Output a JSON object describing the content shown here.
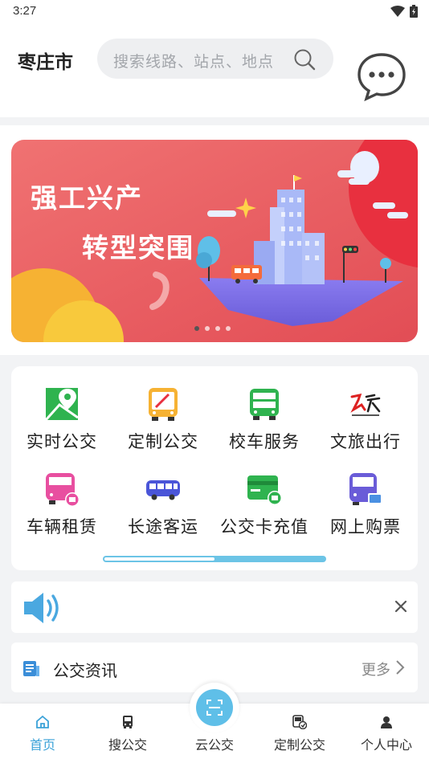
{
  "status_bar": {
    "time": "3:27"
  },
  "header": {
    "city": "枣庄市",
    "search_placeholder": "搜索线路、站点、地点"
  },
  "banner": {
    "line1": "强工兴产",
    "line2": "转型突围",
    "page_count": 4,
    "active_page": 1
  },
  "services": [
    {
      "label": "实时公交",
      "icon": "map-pin-icon"
    },
    {
      "label": "定制公交",
      "icon": "custom-bus-icon"
    },
    {
      "label": "校车服务",
      "icon": "school-bus-icon"
    },
    {
      "label": "文旅出行",
      "icon": "culture-travel-logo-icon"
    },
    {
      "label": "车辆租赁",
      "icon": "rental-bus-icon"
    },
    {
      "label": "长途客运",
      "icon": "coach-bus-icon"
    },
    {
      "label": "公交卡充值",
      "icon": "card-recharge-icon"
    },
    {
      "label": "网上购票",
      "icon": "ticket-bus-icon"
    }
  ],
  "services_scroll_fraction": 0.5,
  "news": {
    "title": "公交资讯",
    "more": "更多"
  },
  "tabs": [
    {
      "label": "首页",
      "icon": "home-icon",
      "active": true
    },
    {
      "label": "搜公交",
      "icon": "bus-icon",
      "active": false
    },
    {
      "label": "云公交",
      "icon": "scan-icon",
      "active": false
    },
    {
      "label": "定制公交",
      "icon": "custom-bus-tab-icon",
      "active": false
    },
    {
      "label": "个人中心",
      "icon": "person-icon",
      "active": false
    }
  ],
  "colors": {
    "accent": "#3ba2d8",
    "banner_red": "#e85d5d",
    "green": "#2fb34f"
  }
}
